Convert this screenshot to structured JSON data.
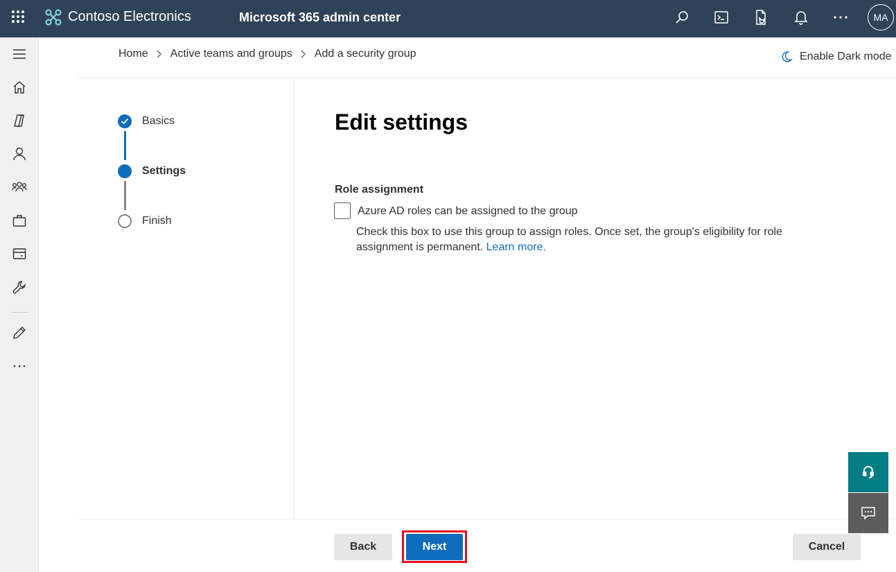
{
  "topbar": {
    "brand": "Contoso Electronics",
    "app_title": "Microsoft 365 admin center",
    "avatar_initials": "MA",
    "icons": [
      "app-launcher-icon",
      "search-icon",
      "terminal-icon",
      "mobile-app-icon",
      "bell-icon",
      "more-icon"
    ]
  },
  "leftnav": {
    "items": [
      "hamburger-icon",
      "home-icon",
      "copilot-icon",
      "user-icon",
      "groups-icon",
      "briefcase-icon",
      "billing-icon",
      "wrench-icon",
      "pencil-icon",
      "more-icon"
    ]
  },
  "breadcrumb": {
    "items": [
      "Home",
      "Active teams and groups",
      "Add a security group"
    ]
  },
  "dark_mode_label": "Enable Dark mode",
  "stepper": {
    "steps": [
      {
        "label": "Basics",
        "status": "completed"
      },
      {
        "label": "Settings",
        "status": "current"
      },
      {
        "label": "Finish",
        "status": "pending"
      }
    ]
  },
  "main": {
    "title": "Edit settings",
    "section_label": "Role assignment",
    "checkbox_label": "Azure AD roles can be assigned to the group",
    "checkbox_checked": false,
    "help_text": "Check this box to use this group to assign roles. Once set, the group's eligibility for role assignment is permanent.",
    "learn_more": "Learn more."
  },
  "footer": {
    "back_label": "Back",
    "next_label": "Next",
    "cancel_label": "Cancel"
  },
  "colors": {
    "topbar": "#2f4358",
    "accent": "#0f6cbd",
    "highlight": "#e3101d",
    "help_button": "#037c84",
    "feedback_button": "#5c5c5c"
  }
}
